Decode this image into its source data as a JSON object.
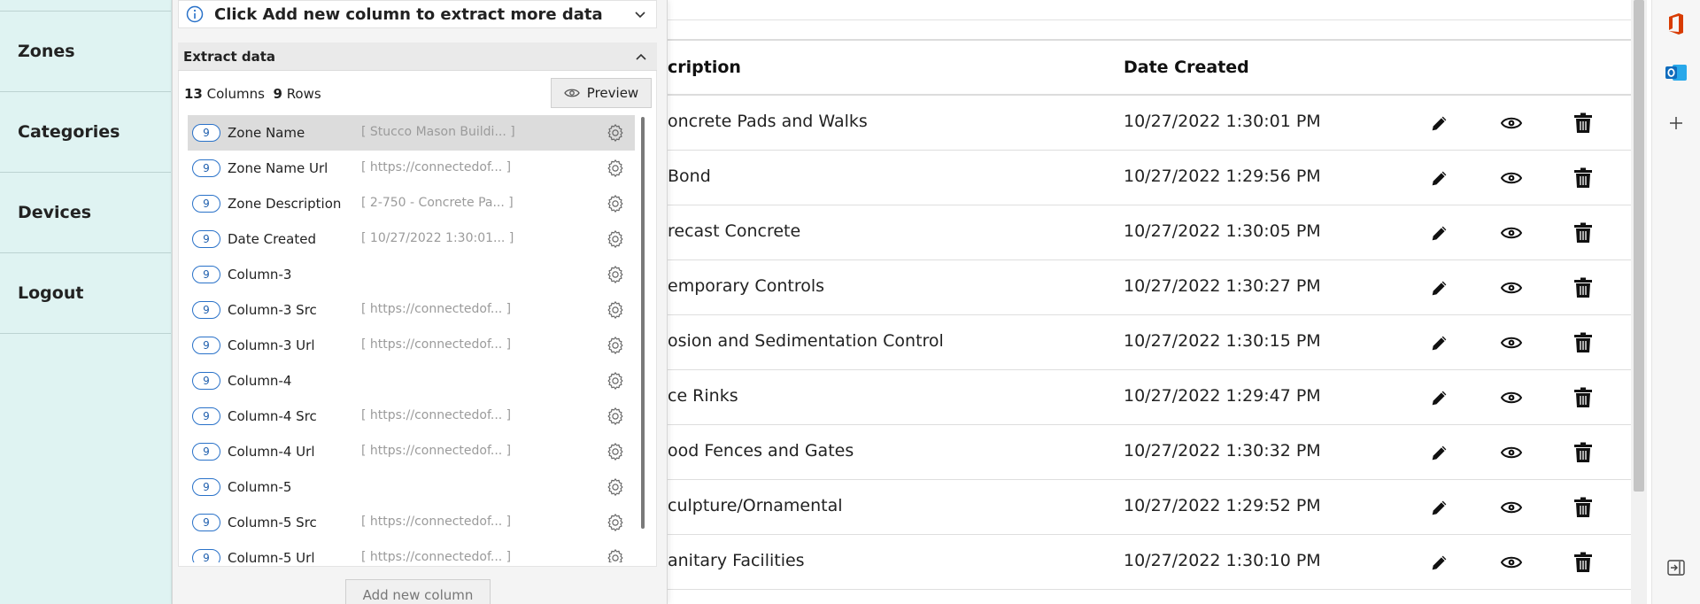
{
  "sidebar": {
    "items": [
      {
        "label": "Zones"
      },
      {
        "label": "Categories"
      },
      {
        "label": "Devices"
      },
      {
        "label": "Logout"
      }
    ]
  },
  "panel": {
    "info_text": "Click Add new column to extract more data",
    "section_title": "Extract data",
    "columns_count": "13",
    "columns_label": "Columns",
    "rows_count": "9",
    "rows_label": "Rows",
    "preview_label": "Preview",
    "add_column_label": "Add new column",
    "columns": [
      {
        "badge": "9",
        "name": "Zone Name",
        "preview": "[ Stucco Mason Buildi... ]"
      },
      {
        "badge": "9",
        "name": "Zone Name Url",
        "preview": "[ https://connectedof... ]"
      },
      {
        "badge": "9",
        "name": "Zone Description",
        "preview": "[ 2-750 - Concrete Pa... ]"
      },
      {
        "badge": "9",
        "name": "Date Created",
        "preview": "[ 10/27/2022 1:30:01... ]"
      },
      {
        "badge": "9",
        "name": "Column-3",
        "preview": ""
      },
      {
        "badge": "9",
        "name": "Column-3 Src",
        "preview": "[ https://connectedof... ]"
      },
      {
        "badge": "9",
        "name": "Column-3 Url",
        "preview": "[ https://connectedof... ]"
      },
      {
        "badge": "9",
        "name": "Column-4",
        "preview": ""
      },
      {
        "badge": "9",
        "name": "Column-4 Src",
        "preview": "[ https://connectedof... ]"
      },
      {
        "badge": "9",
        "name": "Column-4 Url",
        "preview": "[ https://connectedof... ]"
      },
      {
        "badge": "9",
        "name": "Column-5",
        "preview": ""
      },
      {
        "badge": "9",
        "name": "Column-5 Src",
        "preview": "[ https://connectedof... ]"
      },
      {
        "badge": "9",
        "name": "Column-5 Url",
        "preview": "[ https://connectedof... ]"
      }
    ]
  },
  "table": {
    "headers": {
      "description": "cription",
      "date_created": "Date Created"
    },
    "rows": [
      {
        "description": "oncrete Pads and Walks",
        "date": "10/27/2022 1:30:01 PM"
      },
      {
        "description": "Bond",
        "date": "10/27/2022 1:29:56 PM"
      },
      {
        "description": "recast Concrete",
        "date": "10/27/2022 1:30:05 PM"
      },
      {
        "description": "emporary Controls",
        "date": "10/27/2022 1:30:27 PM"
      },
      {
        "description": "osion and Sedimentation Control",
        "date": "10/27/2022 1:30:15 PM"
      },
      {
        "description": "ce Rinks",
        "date": "10/27/2022 1:29:47 PM"
      },
      {
        "description": "ood Fences and Gates",
        "date": "10/27/2022 1:30:32 PM"
      },
      {
        "description": "culpture/Ornamental",
        "date": "10/27/2022 1:29:52 PM"
      },
      {
        "description": "anitary Facilities",
        "date": "10/27/2022 1:30:10 PM"
      }
    ],
    "icons": {
      "edit": "pencil-icon",
      "view": "eye-icon",
      "delete": "trash-icon"
    }
  },
  "rail": {
    "icons": [
      "office-icon",
      "outlook-icon",
      "plus-icon",
      "collapse-pane-icon"
    ]
  },
  "colors": {
    "sidebar_bg": "#dff3f2",
    "badge_blue": "#2a72c9",
    "office_red": "#d83b01",
    "outlook_blue": "#0f6cbd"
  }
}
